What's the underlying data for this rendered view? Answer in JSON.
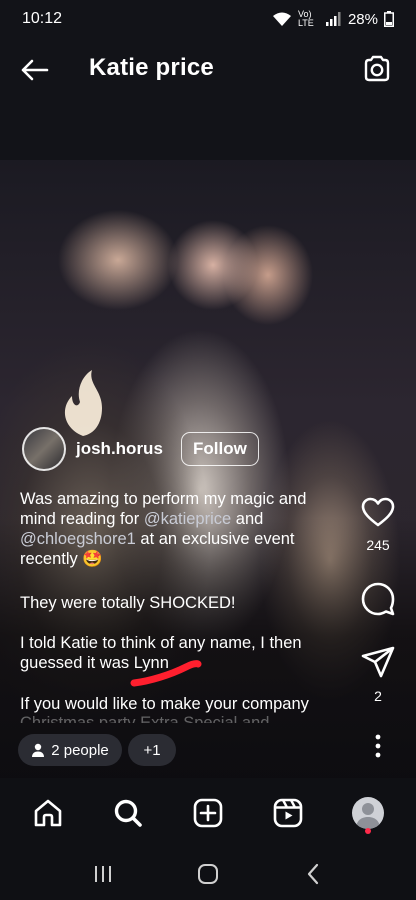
{
  "status_bar": {
    "time": "10:12",
    "network": "Vo) LTE",
    "battery": "28%"
  },
  "header": {
    "title": "Katie price"
  },
  "post": {
    "author": "josh.horus",
    "follow_label": "Follow",
    "caption": {
      "line1_prefix": "Was amazing to perform my magic and mind reading for ",
      "mention1": "@katieprice",
      "line1_mid": " and ",
      "mention2": "@chloegshore1",
      "line1_suffix": " at an exclusive event recently ",
      "emoji": "🤩",
      "para2": "They were totally SHOCKED!",
      "para3": "I told Katie to think of any name, I then guessed it was Lynn",
      "para4": "If you would like to make your company",
      "para5": "Christmas party Extra Special and"
    },
    "likes": "245",
    "shares": "2",
    "tagged_people": "2 people",
    "tagged_more": "+1"
  },
  "icons": {
    "back": "arrow-left-icon",
    "camera": "camera-icon",
    "like": "heart-icon",
    "comment": "comment-icon",
    "share": "send-icon",
    "more": "more-vertical-icon",
    "person": "person-icon",
    "home": "home-icon",
    "search": "search-icon",
    "create": "plus-square-icon",
    "reels": "reels-icon",
    "profile": "profile-avatar"
  },
  "colors": {
    "background": "#121318",
    "notification_dot": "#ff2a4a",
    "scribble": "#ff1f2e"
  }
}
